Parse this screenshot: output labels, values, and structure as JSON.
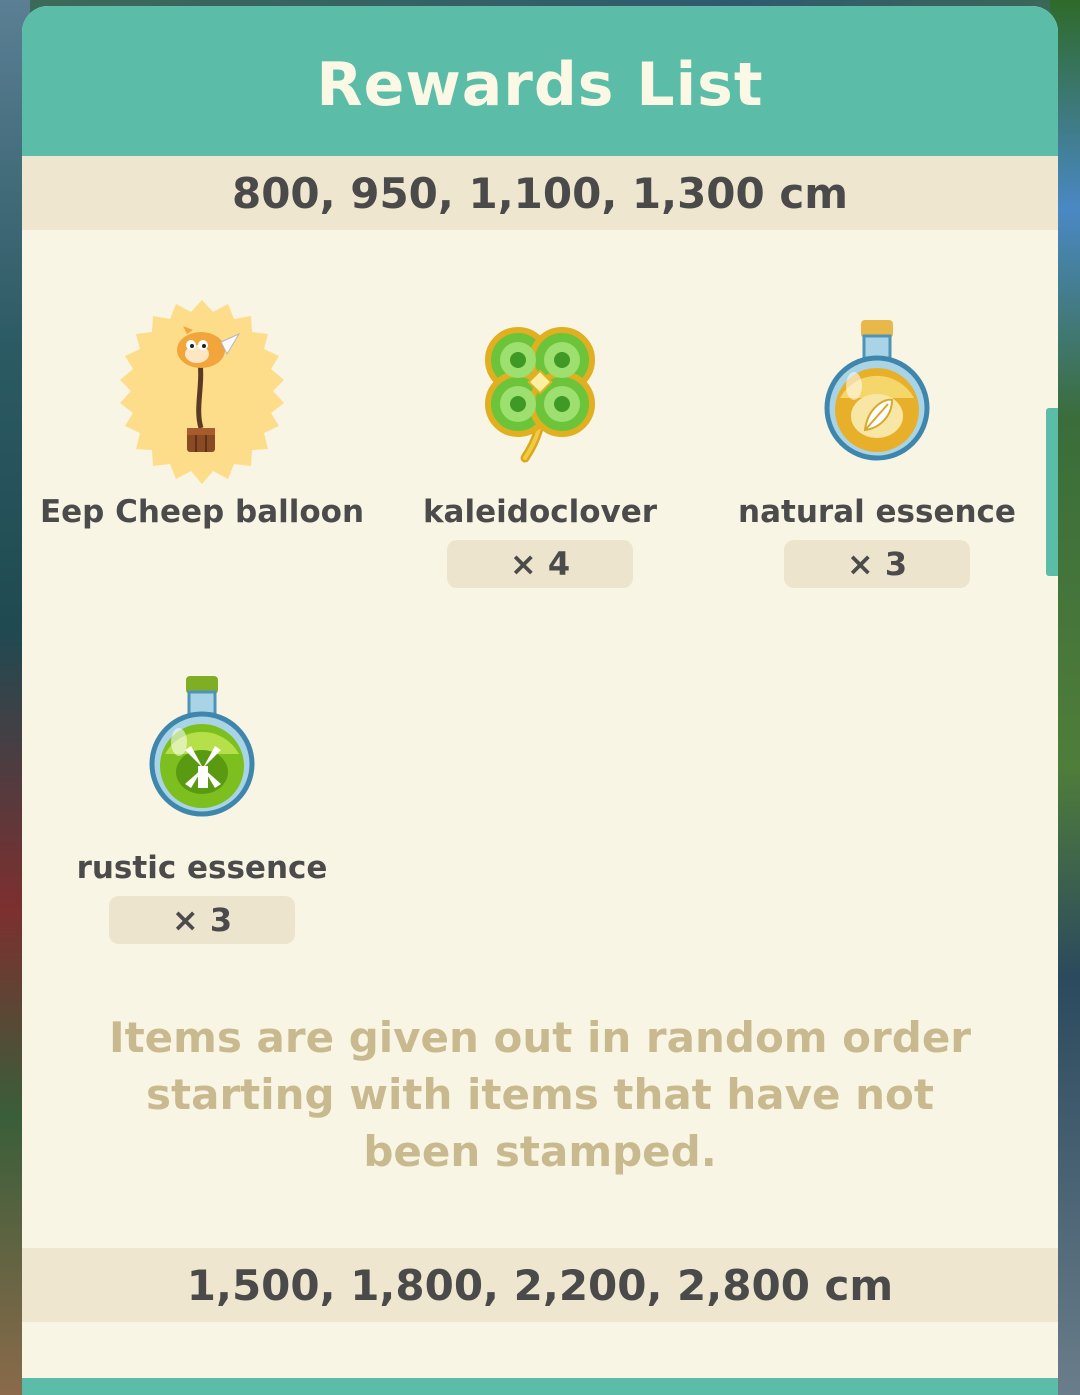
{
  "panel": {
    "title": "Rewards List"
  },
  "tiers": [
    {
      "distances": "800, 950, 1,100, 1,300 cm",
      "rewards": [
        {
          "name": "Eep Cheep balloon",
          "quantity": null,
          "icon": "eep-cheep-balloon-icon",
          "highlighted": true
        },
        {
          "name": "kaleidoclover",
          "quantity": "× 4",
          "icon": "four-leaf-clover-icon",
          "highlighted": false
        },
        {
          "name": "natural essence",
          "quantity": "× 3",
          "icon": "leaf-potion-icon",
          "highlighted": false
        },
        {
          "name": "rustic essence",
          "quantity": "× 3",
          "icon": "windmill-potion-icon",
          "highlighted": false
        }
      ],
      "note_lines": [
        "Items are given out in random order",
        "starting with items that have not",
        "been stamped."
      ]
    },
    {
      "distances": "1,500, 1,800, 2,200, 2,800 cm"
    }
  ],
  "colors": {
    "header": "#5bbda8",
    "panel_bg": "#f8f5e4",
    "band": "#efe6cf",
    "qty_bg": "#ece4cc",
    "note_text": "#c9b98e",
    "highlight_burst": "#fddc8a"
  }
}
